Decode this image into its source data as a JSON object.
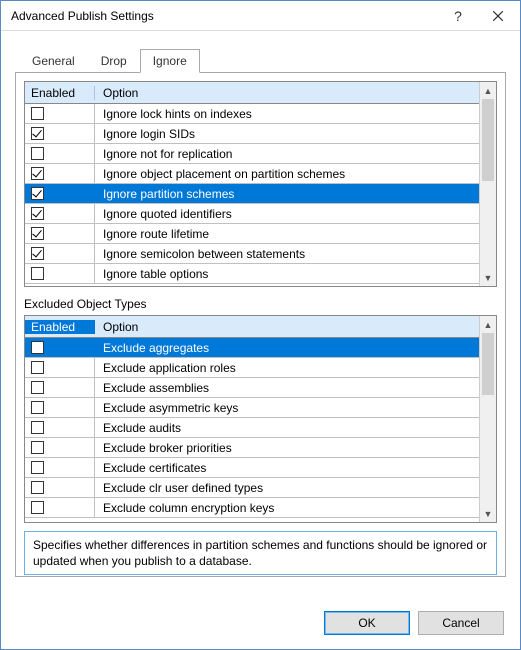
{
  "window": {
    "title": "Advanced Publish Settings"
  },
  "tabs": {
    "items": [
      {
        "label": "General",
        "active": false
      },
      {
        "label": "Drop",
        "active": false
      },
      {
        "label": "Ignore",
        "active": true
      }
    ]
  },
  "ignoreGrid": {
    "headers": {
      "enabled": "Enabled",
      "option": "Option"
    },
    "rows": [
      {
        "enabled": false,
        "option": "Ignore lock hints on indexes",
        "selected": false
      },
      {
        "enabled": true,
        "option": "Ignore login SIDs",
        "selected": false
      },
      {
        "enabled": false,
        "option": "Ignore not for replication",
        "selected": false
      },
      {
        "enabled": true,
        "option": "Ignore object placement on partition schemes",
        "selected": false
      },
      {
        "enabled": true,
        "option": "Ignore partition schemes",
        "selected": true
      },
      {
        "enabled": true,
        "option": "Ignore quoted identifiers",
        "selected": false
      },
      {
        "enabled": true,
        "option": "Ignore route lifetime",
        "selected": false
      },
      {
        "enabled": true,
        "option": "Ignore semicolon between statements",
        "selected": false
      },
      {
        "enabled": false,
        "option": "Ignore table options",
        "selected": false
      }
    ]
  },
  "excludedSection": {
    "label": "Excluded Object Types"
  },
  "excludedGrid": {
    "headers": {
      "enabled": "Enabled",
      "option": "Option"
    },
    "headerSelected": true,
    "rows": [
      {
        "enabled": false,
        "option": "Exclude aggregates",
        "selected": true
      },
      {
        "enabled": false,
        "option": "Exclude application roles",
        "selected": false
      },
      {
        "enabled": false,
        "option": "Exclude assemblies",
        "selected": false
      },
      {
        "enabled": false,
        "option": "Exclude asymmetric keys",
        "selected": false
      },
      {
        "enabled": false,
        "option": "Exclude audits",
        "selected": false
      },
      {
        "enabled": false,
        "option": "Exclude broker priorities",
        "selected": false
      },
      {
        "enabled": false,
        "option": "Exclude certificates",
        "selected": false
      },
      {
        "enabled": false,
        "option": "Exclude clr user defined types",
        "selected": false
      },
      {
        "enabled": false,
        "option": "Exclude column encryption keys",
        "selected": false
      }
    ]
  },
  "description": {
    "text": "Specifies whether differences in partition schemes and functions should be ignored or updated when you publish to a database."
  },
  "buttons": {
    "ok": "OK",
    "cancel": "Cancel"
  },
  "titlebar": {
    "help": "?"
  }
}
